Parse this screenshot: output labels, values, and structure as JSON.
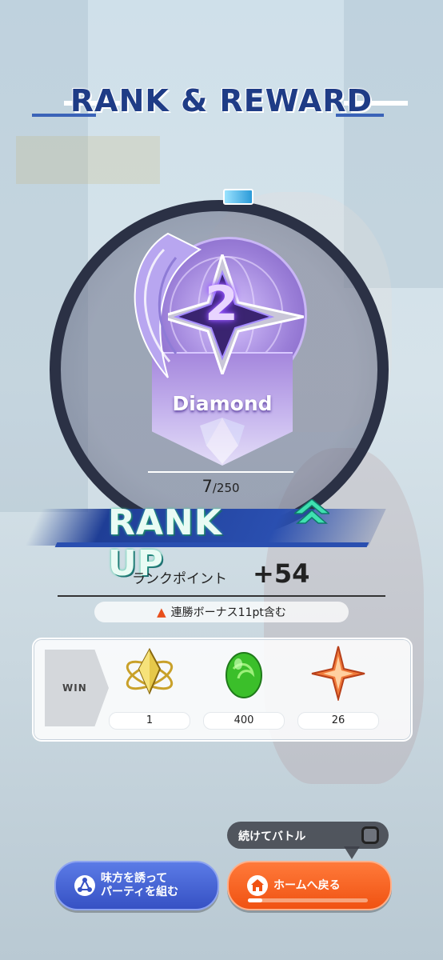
{
  "header": {
    "title": "RANK & REWARD"
  },
  "rank": {
    "tier_name": "Diamond",
    "tier_number": "2",
    "progress_current": "7",
    "progress_max": "/250",
    "progress_fraction": 0.028
  },
  "rank_up": {
    "label": "RANK UP"
  },
  "points": {
    "label": "ランクポイント",
    "value": "+54",
    "bonus_text": "連勝ボーナス11pt含む"
  },
  "rewards": {
    "tag": "WIN",
    "items": [
      {
        "icon": "golden-atom-crystal-icon",
        "count": "1"
      },
      {
        "icon": "green-egg-icon",
        "count": "400"
      },
      {
        "icon": "orange-star-crystal-icon",
        "count": "26"
      }
    ]
  },
  "continue_battle": {
    "label": "続けてバトル"
  },
  "buttons": {
    "party": {
      "line1": "味方を誘って",
      "line2": "パーティを組む"
    },
    "home": {
      "label": "ホームへ戻る",
      "timer_fraction": 0.12
    }
  },
  "colors": {
    "title": "#1f3c86",
    "party_button": "#3651c4",
    "home_button": "#f05212",
    "rank_emblem": "#9b7fd8",
    "rank_up_text": "#e9fbf4"
  }
}
